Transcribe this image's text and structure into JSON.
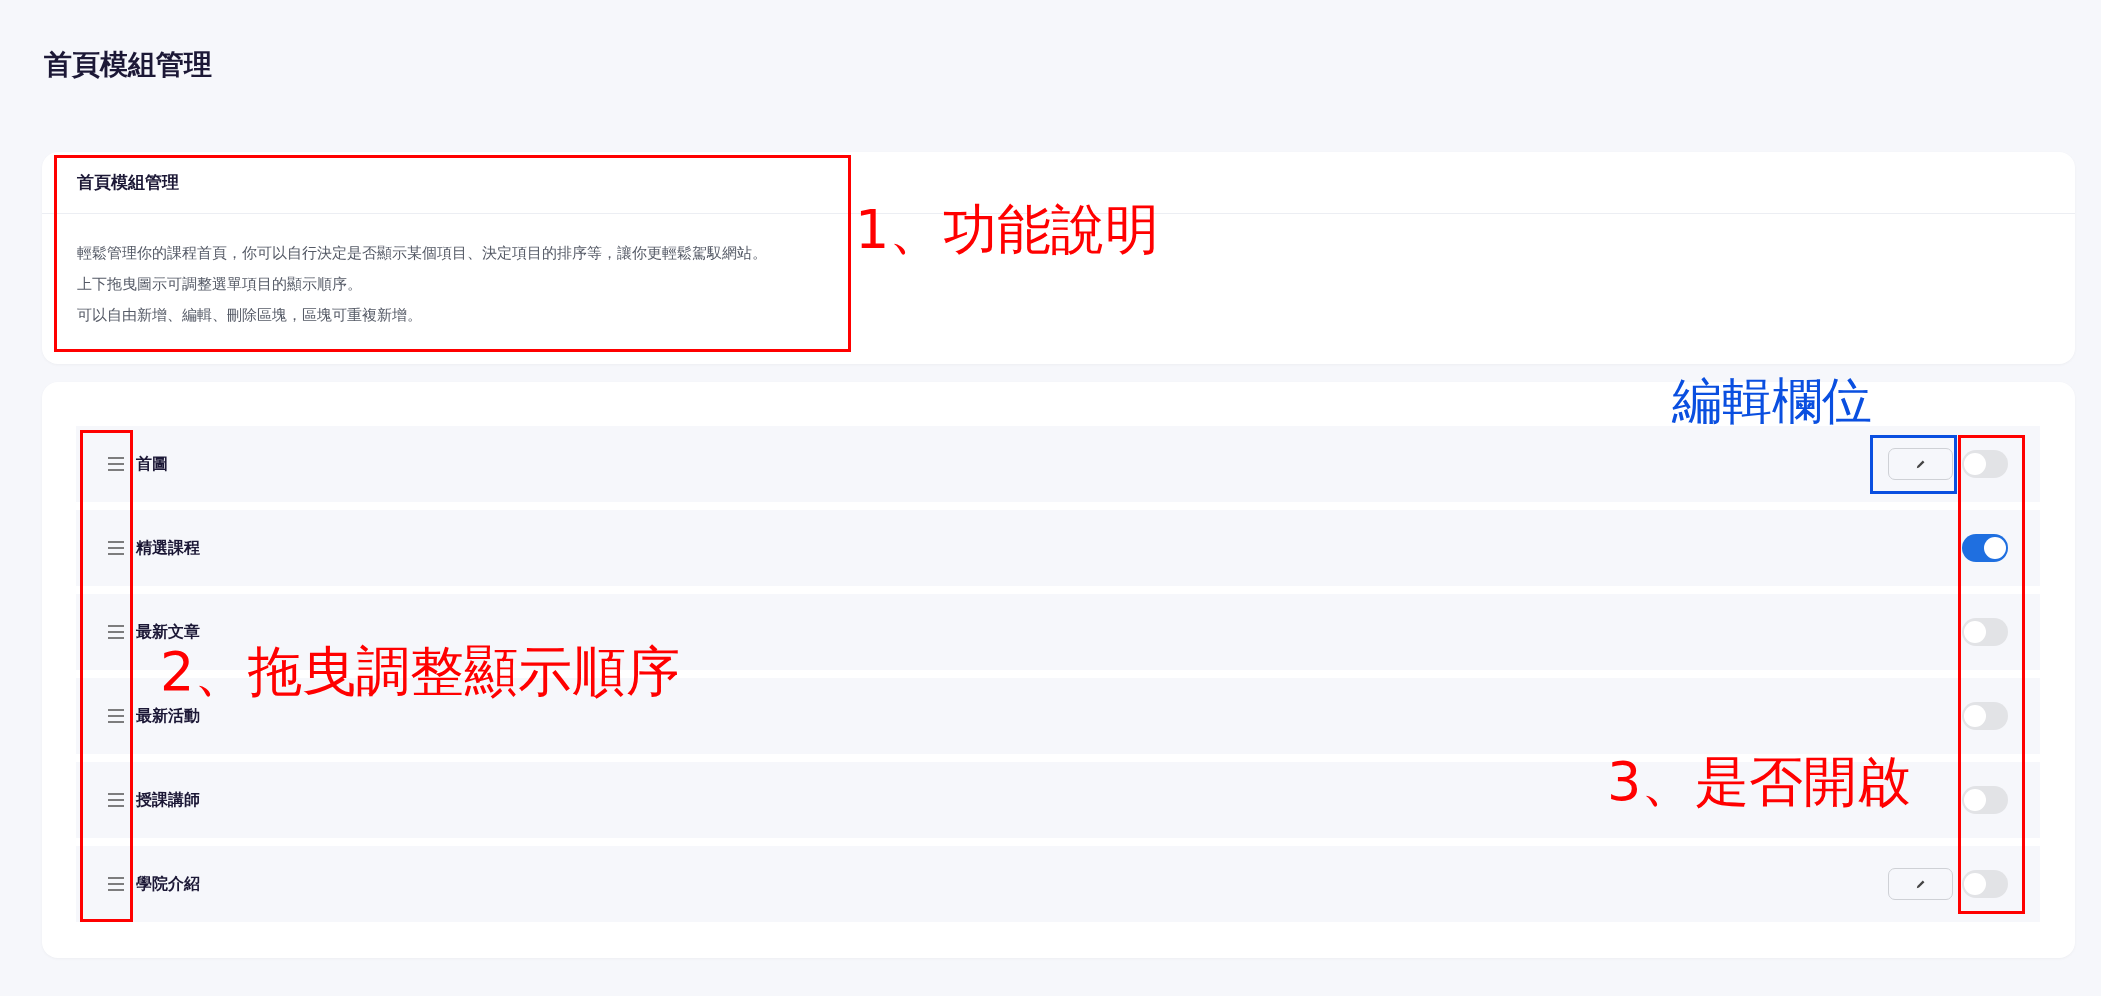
{
  "page_title": "首頁模組管理",
  "info_card": {
    "title": "首頁模組管理",
    "lines": [
      "輕鬆管理你的課程首頁，你可以自行決定是否顯示某個項目、決定項目的排序等，讓你更輕鬆駕馭網站。",
      "上下拖曳圖示可調整選單項目的顯示順序。",
      "可以自由新增、編輯、刪除區塊，區塊可重複新增。"
    ]
  },
  "modules": [
    {
      "label": "首圖",
      "editable": true,
      "on": false
    },
    {
      "label": "精選課程",
      "editable": false,
      "on": true
    },
    {
      "label": "最新文章",
      "editable": false,
      "on": false
    },
    {
      "label": "最新活動",
      "editable": false,
      "on": false
    },
    {
      "label": "授課講師",
      "editable": false,
      "on": false
    },
    {
      "label": "學院介紹",
      "editable": true,
      "on": false
    }
  ],
  "annotations": [
    {
      "kind": "box",
      "color": "#ff0000"
    },
    {
      "kind": "label",
      "color": "#ff0000",
      "text": "1、功能說明"
    },
    {
      "kind": "label",
      "color": "#0a4fe0",
      "text": "編輯欄位"
    },
    {
      "kind": "box",
      "color": "#0a4fe0"
    },
    {
      "kind": "box",
      "color": "#ff0000"
    },
    {
      "kind": "label",
      "color": "#ff0000",
      "text": "2、拖曳調整顯示順序"
    },
    {
      "kind": "box",
      "color": "#ff0000"
    },
    {
      "kind": "label",
      "color": "#ff0000",
      "text": "3、是否開啟"
    }
  ]
}
